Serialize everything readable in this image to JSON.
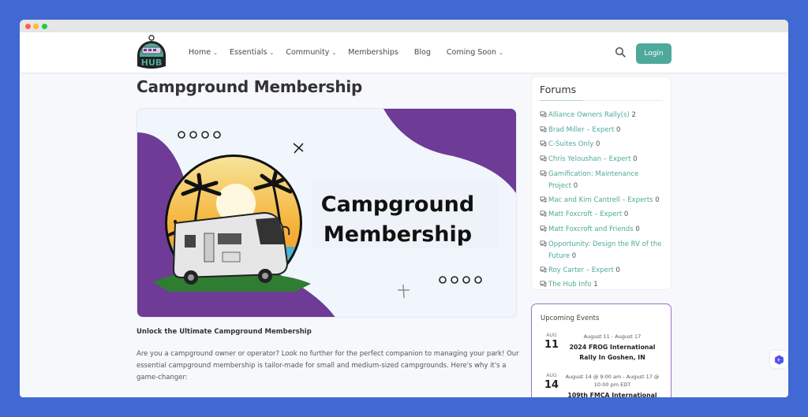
{
  "window": {
    "controls": [
      "close",
      "minimize",
      "maximize"
    ]
  },
  "header": {
    "logo_alt": "The Hub",
    "nav": [
      {
        "label": "Home",
        "has_dropdown": true
      },
      {
        "label": "Essentials",
        "has_dropdown": true
      },
      {
        "label": "Community",
        "has_dropdown": true
      },
      {
        "label": "Memberships",
        "has_dropdown": false
      },
      {
        "label": "Blog",
        "has_dropdown": false
      },
      {
        "label": "Coming Soon",
        "has_dropdown": true
      }
    ],
    "search_icon": "search-icon",
    "login_label": "Login",
    "accent": "#4ea99a"
  },
  "main": {
    "title": "Campground Membership",
    "hero": {
      "line1": "Campground",
      "line2": "Membership",
      "accent": "#6e3b96"
    },
    "intro_heading": "Unlock the Ultimate Campground Membership",
    "intro_text": "Are you a campground owner or operator? Look no further for the perfect companion to managing your park! Our essential campground membership is tailor-made for small and medium-sized campgrounds. Here's why it's a game-changer:"
  },
  "sidebar": {
    "forums": {
      "title": "Forums",
      "items": [
        {
          "name": "Alliance Owners Rally(s)",
          "count": "2"
        },
        {
          "name": "Brad Miller – Expert",
          "count": "0"
        },
        {
          "name": "C-Suites Only",
          "count": "0"
        },
        {
          "name": "Chris Yeloushan – Expert",
          "count": "0"
        },
        {
          "name": "Gamification: Maintenance Project",
          "count": "0"
        },
        {
          "name": "Mac and Kim Cantrell – Experts",
          "count": "0"
        },
        {
          "name": "Matt Foxcroft – Expert",
          "count": "0"
        },
        {
          "name": "Matt Foxcroft and Friends",
          "count": "0"
        },
        {
          "name": "Opportunity: Design the RV of the Future",
          "count": "0"
        },
        {
          "name": "Roy Carter – Expert",
          "count": "0"
        },
        {
          "name": "The Hub Info",
          "count": "1"
        }
      ]
    },
    "events": {
      "title": "Upcoming Events",
      "items": [
        {
          "month": "AUG",
          "day": "11",
          "time": "August 11 - August 17",
          "name": "2024 FROG International Rally In Goshen, IN"
        },
        {
          "month": "AUG",
          "day": "14",
          "time": "August 14 @ 9:00 am - August 17 @ 10:00 pm EDT",
          "name": "109th FMCA International"
        }
      ]
    }
  }
}
